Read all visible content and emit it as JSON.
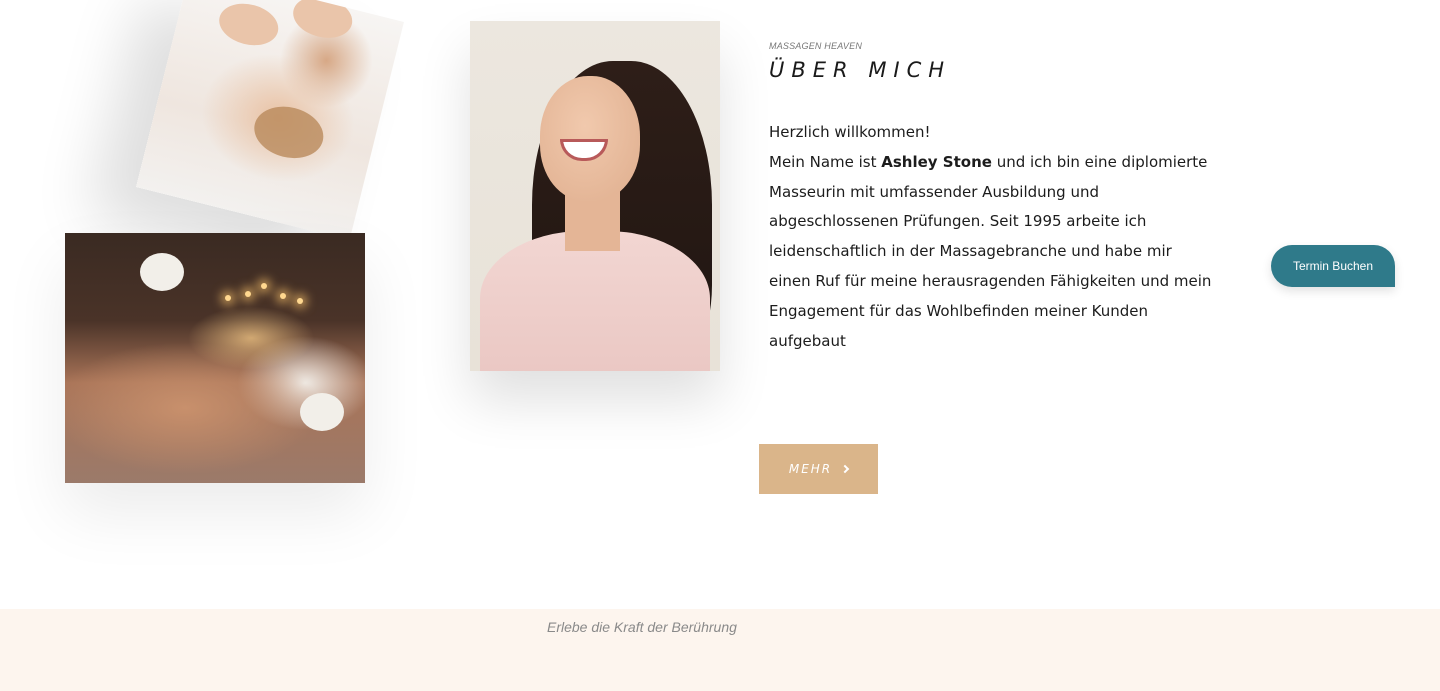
{
  "about": {
    "eyebrow": "MASSAGEN HEAVEN",
    "title": "ÜBER MICH",
    "greeting": "Herzlich willkommen!",
    "intro_prefix": "Mein Name ist ",
    "name": "Ashley Stone",
    "intro_suffix": " und ich bin eine diplomierte Masseurin mit umfassender Ausbildung und abgeschlossenen Prüfungen. Seit 1995 arbeite ich leidenschaftlich in der Massagebranche und habe mir einen Ruf für meine herausragenden Fähigkeiten und mein Engagement für das Wohlbefinden meiner Kunden aufgebaut",
    "more_label": "MEHR",
    "more_icon": "chevron-right-icon"
  },
  "booking": {
    "label": "Termin Buchen",
    "color": "#2f7a8a"
  },
  "footer_strip": {
    "tagline": "Erlebe die Kraft der Berührung"
  },
  "colors": {
    "accent_gold": "#dab58a",
    "teal": "#2f7a8a",
    "strip_bg": "#fdf5ee"
  }
}
